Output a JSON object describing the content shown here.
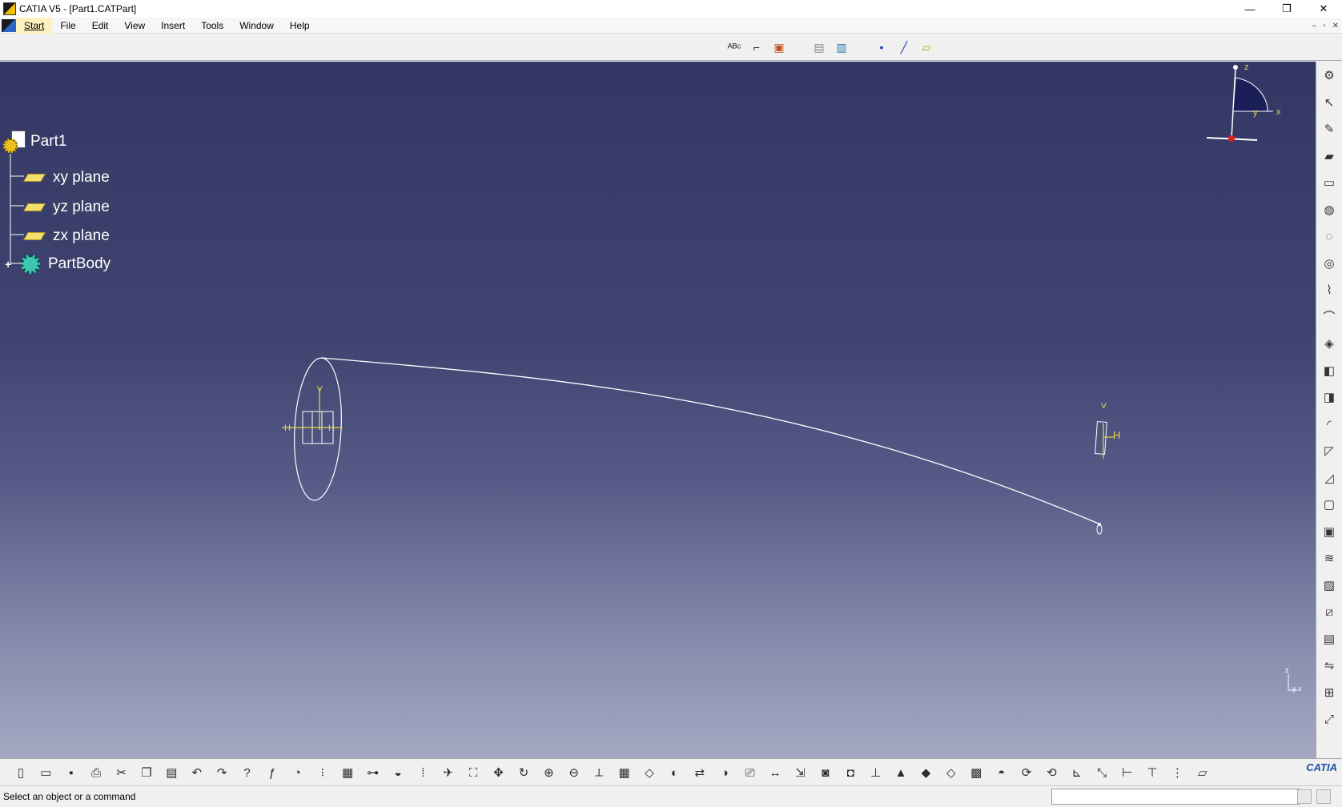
{
  "window": {
    "title": "CATIA V5 - [Part1.CATPart]",
    "controls": {
      "minimize": "—",
      "restore": "❐",
      "close": "✕"
    }
  },
  "menubar": {
    "items": [
      {
        "label": "Start",
        "active": true
      },
      {
        "label": "File"
      },
      {
        "label": "Edit"
      },
      {
        "label": "View"
      },
      {
        "label": "Insert"
      },
      {
        "label": "Tools"
      },
      {
        "label": "Window"
      },
      {
        "label": "Help"
      }
    ],
    "mdi_controls": {
      "minimize": "–",
      "restore": "▫",
      "close": "✕"
    }
  },
  "top_toolbar": {
    "buttons": [
      {
        "name": "text-with-leader-icon",
        "glyph": "ᴬᴮᶜ"
      },
      {
        "name": "annotation-flag-icon",
        "glyph": "⌐"
      },
      {
        "name": "apply-material-icon",
        "glyph": "▣"
      },
      {
        "name": "catalog-browser-icon",
        "glyph": "▤"
      },
      {
        "name": "measure-inertia-icon",
        "glyph": "▥"
      },
      {
        "name": "point-icon",
        "glyph": "•"
      },
      {
        "name": "line-icon",
        "glyph": "╱"
      },
      {
        "name": "plane-icon",
        "glyph": "▱"
      }
    ]
  },
  "tree": {
    "root": "Part1",
    "children": [
      "xy plane",
      "yz plane",
      "zx plane"
    ],
    "body": "PartBody"
  },
  "viewport": {
    "compass_labels": {
      "z": "z",
      "x": "x",
      "y": "y"
    },
    "sketch_labels": {
      "h": "H",
      "v": "V"
    },
    "mini_axis": {
      "z": "z",
      "yx": "y x"
    }
  },
  "right_toolbar": {
    "buttons": [
      "gear-settings-icon",
      "select-arrow-icon",
      "sketcher-icon",
      "pad-icon",
      "pocket-icon",
      "shaft-icon",
      "groove-icon",
      "hole-icon",
      "rib-icon",
      "slot-icon",
      "solid-combine-icon",
      "multi-section-solid-icon",
      "removed-multi-section-icon",
      "fillet-icon",
      "chamfer-icon",
      "draft-icon",
      "shell-icon",
      "thickness-icon",
      "thread-icon",
      "remove-face-icon",
      "split-icon",
      "thick-surface-icon",
      "mirror-icon",
      "pattern-icon",
      "scaling-icon"
    ]
  },
  "bottom_toolbar": {
    "buttons": [
      "new-icon",
      "open-icon",
      "save-icon",
      "print-icon",
      "cut-icon",
      "copy-icon",
      "paste-icon",
      "undo-icon",
      "redo-icon",
      "whats-this-icon",
      "formula-icon",
      "knowledge-advisor-icon",
      "catalog-icon",
      "table-icon",
      "hierarchical-icon",
      "sketch-analysis-icon",
      "quick-view-icon",
      "fly-mode-icon",
      "fit-all-icon",
      "pan-icon",
      "rotate-icon",
      "zoom-in-icon",
      "zoom-out-icon",
      "normal-view-icon",
      "multi-view-icon",
      "iso-view-icon",
      "hide-show-icon",
      "swap-space-icon",
      "shading-icon",
      "capture-icon",
      "measure-between-icon",
      "measure-item-icon",
      "apply-material-icon",
      "camera-icon",
      "axis-system-icon",
      "body-icon",
      "geometrical-set-icon",
      "ordered-set-icon",
      "draft-analysis-icon",
      "curvature-analysis-icon",
      "refresh-icon",
      "update-icon",
      "axis-icon",
      "scale-icon",
      "constraint-icon",
      "relimit-icon",
      "level-icon",
      "surface-icon"
    ],
    "logo": "CATIA"
  },
  "statusbar": {
    "message": "Select an object or a command",
    "input_value": ""
  }
}
